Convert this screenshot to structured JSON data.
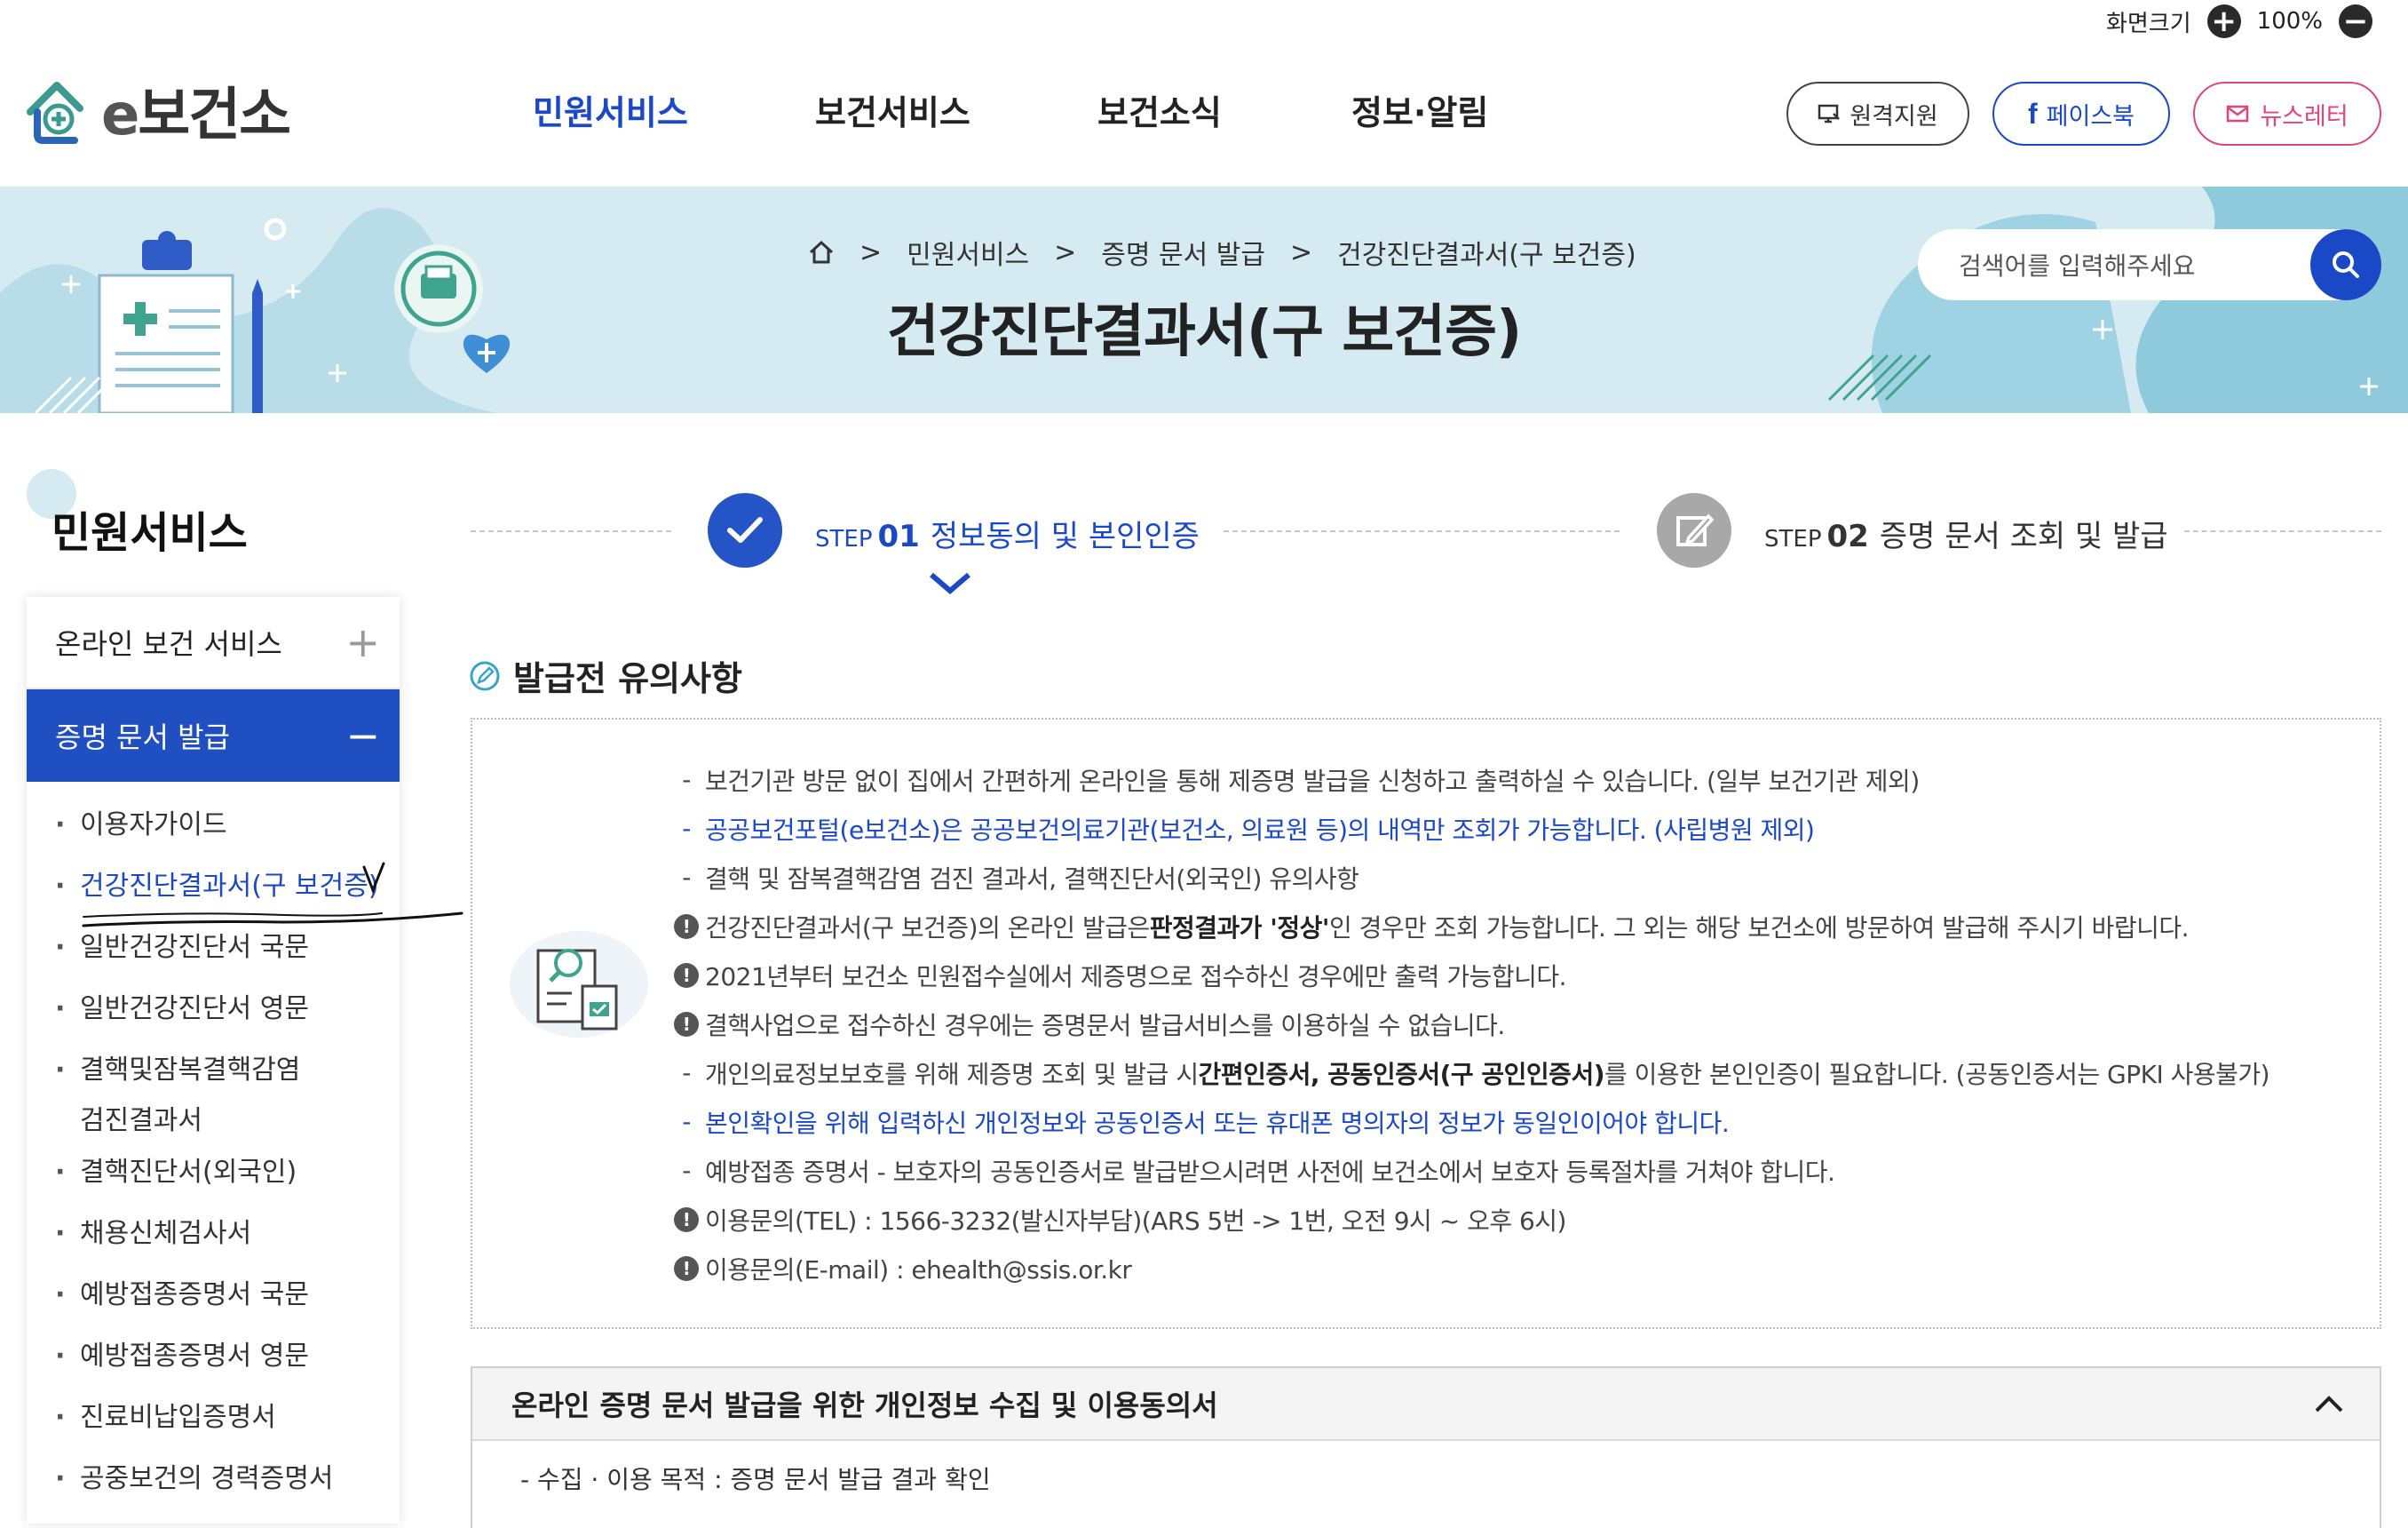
{
  "utility": {
    "zoom_label": "화면크기",
    "zoom_in": "+",
    "zoom_value": "100%",
    "zoom_out": "−"
  },
  "logo": {
    "prefix": "e",
    "name": "보건소"
  },
  "gnb": [
    {
      "label": "민원서비스",
      "active": true
    },
    {
      "label": "보건서비스",
      "active": false
    },
    {
      "label": "보건소식",
      "active": false
    },
    {
      "label": "정보·알림",
      "active": false
    }
  ],
  "header_buttons": [
    {
      "label": "원격지원",
      "icon": "monitor-icon",
      "color": "#333333"
    },
    {
      "label": "페이스북",
      "icon": "facebook-icon",
      "color": "#1a48c6"
    },
    {
      "label": "뉴스레터",
      "icon": "mail-icon",
      "color": "#e0457b"
    }
  ],
  "breadcrumb": {
    "home_icon": "home-icon",
    "items": [
      "민원서비스",
      "증명 문서 발급",
      "건강진단결과서(구 보건증)"
    ]
  },
  "page_title": "건강진단결과서(구 보건증)",
  "search": {
    "placeholder": "검색어를 입력해주세요",
    "icon": "search-icon"
  },
  "sidebar": {
    "title": "민원서비스",
    "groups": [
      {
        "label": "온라인 보건 서비스",
        "toggle": "+",
        "open": false
      },
      {
        "label": "증명 문서 발급",
        "toggle": "−",
        "open": true
      }
    ],
    "items": [
      {
        "label": "이용자가이드"
      },
      {
        "label": "건강진단결과서(구 보건증)",
        "current": true
      },
      {
        "label": "일반건강진단서 국문"
      },
      {
        "label": "일반건강진단서 영문"
      },
      {
        "label": "결핵및잠복결핵감염",
        "label2": "검진결과서"
      },
      {
        "label": "결핵진단서(외국인)"
      },
      {
        "label": "채용신체검사서"
      },
      {
        "label": "예방접종증명서 국문"
      },
      {
        "label": "예방접종증명서 영문"
      },
      {
        "label": "진료비납입증명서"
      },
      {
        "label": "공중보건의 경력증명서"
      }
    ]
  },
  "steps": [
    {
      "prefix": "STEP",
      "num": "01",
      "label": "정보동의 및 본인인증",
      "state": "active",
      "icon": "check-icon"
    },
    {
      "prefix": "STEP",
      "num": "02",
      "label": "증명 문서 조회 및 발급",
      "state": "inactive",
      "icon": "pencil-icon"
    }
  ],
  "notice": {
    "title": "발급전 유의사항",
    "lines": [
      {
        "type": "dash",
        "text": "보건기관 방문 없이 집에서 간편하게 온라인을 통해 제증명 발급을 신청하고 출력하실 수 있습니다. (일부 보건기관 제외)"
      },
      {
        "type": "dash-blue",
        "text": "공공보건포털(e보건소)은 공공보건의료기관(보건소, 의료원 등)의 내역만 조회가 가능합니다. (사립병원 제외)"
      },
      {
        "type": "dash",
        "text": "결핵 및 잠복결핵감염 검진 결과서, 결핵진단서(외국인) 유의사항"
      },
      {
        "type": "warn",
        "text_a": "건강진단결과서(구 보건증)의 온라인 발급은 ",
        "bold": "판정결과가 '정상'",
        "text_b": "인 경우만 조회 가능합니다. 그 외는 해당 보건소에 방문하여 발급해 주시기 바랍니다."
      },
      {
        "type": "warn",
        "text": "2021년부터 보건소 민원접수실에서 제증명으로 접수하신 경우에만 출력 가능합니다."
      },
      {
        "type": "warn",
        "text": "결핵사업으로 접수하신 경우에는 증명문서 발급서비스를 이용하실 수 없습니다."
      },
      {
        "type": "dash",
        "text_a": "개인의료정보보호를 위해 제증명 조회 및 발급 시 ",
        "bold": "간편인증서, 공동인증서(구 공인인증서)",
        "text_b": "를 이용한 본인인증이 필요합니다. (공동인증서는 GPKI 사용불가)"
      },
      {
        "type": "dash-blue",
        "text": "본인확인을 위해 입력하신 개인정보와 공동인증서 또는 휴대폰 명의자의 정보가 동일인이어야 합니다."
      },
      {
        "type": "dash",
        "text": "예방접종 증명서 - 보호자의 공동인증서로 발급받으시려면 사전에 보건소에서 보호자 등록절차를 거쳐야 합니다."
      },
      {
        "type": "warn",
        "text": "이용문의(TEL) : 1566-3232(발신자부담)(ARS 5번 -> 1번, 오전 9시 ~ 오후 6시)"
      },
      {
        "type": "warn",
        "text": "이용문의(E-mail) : ehealth@ssis.or.kr"
      }
    ]
  },
  "consent": {
    "title": "온라인 증명 문서 발급을 위한 개인정보 수집 및 이용동의서",
    "line1": "- 수집 · 이용 목적 : 증명 문서 발급 결과 확인"
  },
  "colors": {
    "primary": "#1a48c6",
    "sidebar_active": "#1f4fc1",
    "banner": "#d5eaf1",
    "newsletter": "#e0457b"
  }
}
